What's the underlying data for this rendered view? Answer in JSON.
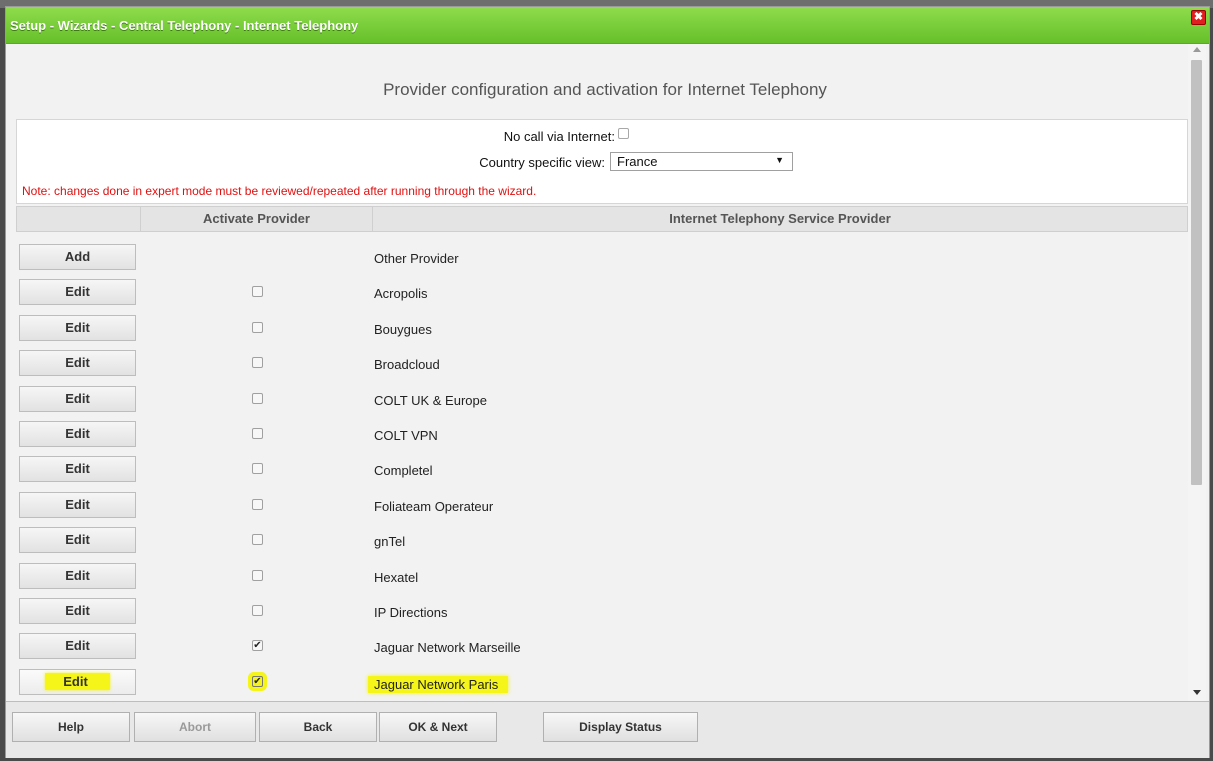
{
  "window": {
    "title": "Setup - Wizards - Central Telephony - Internet Telephony",
    "close_glyph": "✖"
  },
  "heading": "Provider configuration and activation for Internet Telephony",
  "options": {
    "no_call_label": "No call via Internet:",
    "no_call_checked": false,
    "country_label": "Country specific view:",
    "country_value": "France",
    "note": "Note: changes done in expert mode must be reviewed/repeated after running through the wizard."
  },
  "table": {
    "col_activate": "Activate Provider",
    "col_provider": "Internet Telephony Service Provider",
    "rows": [
      {
        "button": "Add",
        "checkbox": null,
        "provider": "Other Provider",
        "highlight": false
      },
      {
        "button": "Edit",
        "checkbox": false,
        "provider": "Acropolis",
        "highlight": false
      },
      {
        "button": "Edit",
        "checkbox": false,
        "provider": "Bouygues",
        "highlight": false
      },
      {
        "button": "Edit",
        "checkbox": false,
        "provider": "Broadcloud",
        "highlight": false
      },
      {
        "button": "Edit",
        "checkbox": false,
        "provider": "COLT UK & Europe",
        "highlight": false
      },
      {
        "button": "Edit",
        "checkbox": false,
        "provider": "COLT VPN",
        "highlight": false
      },
      {
        "button": "Edit",
        "checkbox": false,
        "provider": "Completel",
        "highlight": false
      },
      {
        "button": "Edit",
        "checkbox": false,
        "provider": "Foliateam Operateur",
        "highlight": false
      },
      {
        "button": "Edit",
        "checkbox": false,
        "provider": "gnTel",
        "highlight": false
      },
      {
        "button": "Edit",
        "checkbox": false,
        "provider": "Hexatel",
        "highlight": false
      },
      {
        "button": "Edit",
        "checkbox": false,
        "provider": "IP Directions",
        "highlight": false
      },
      {
        "button": "Edit",
        "checkbox": true,
        "provider": "Jaguar Network Marseille",
        "highlight": false
      },
      {
        "button": "Edit",
        "checkbox": true,
        "provider": "Jaguar Network Paris",
        "highlight": true
      }
    ]
  },
  "footer": {
    "help": "Help",
    "abort": "Abort",
    "back": "Back",
    "ok_next": "OK & Next",
    "display_status": "Display Status"
  },
  "colors": {
    "titlebar": "#6fc832",
    "highlight": "#f5f51a",
    "note": "#e01010"
  }
}
